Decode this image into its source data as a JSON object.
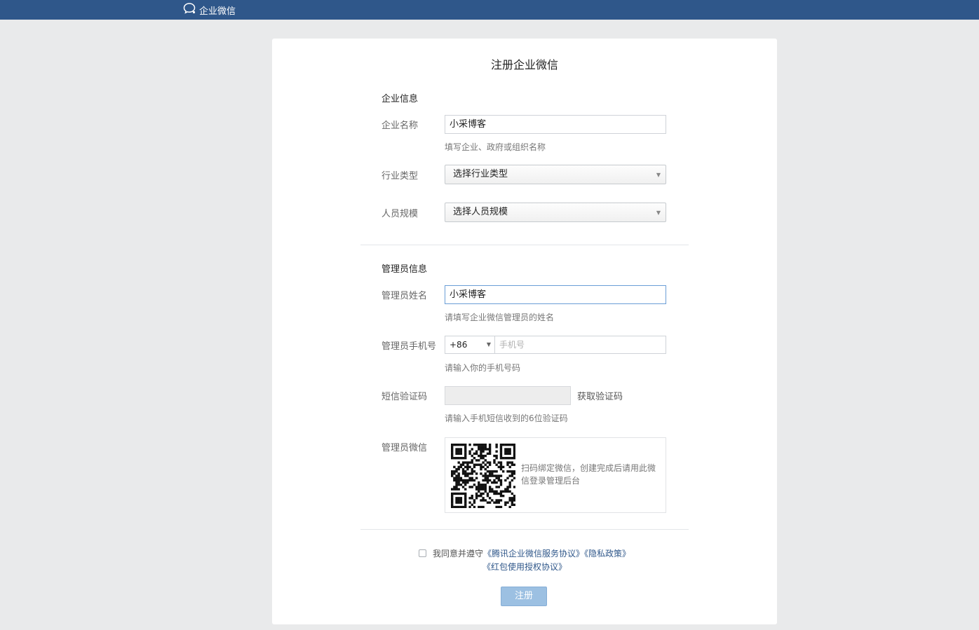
{
  "header": {
    "brand_name": "企业微信",
    "brand_icon": "chat-bubble-icon",
    "bar_color": "#2f578a"
  },
  "form": {
    "title": "注册企业微信",
    "company_section": {
      "title": "企业信息",
      "name_label": "企业名称",
      "name_value": "小采博客",
      "name_hint": "填写企业、政府或组织名称",
      "industry_label": "行业类型",
      "industry_value": "选择行业类型",
      "size_label": "人员规模",
      "size_value": "选择人员规模"
    },
    "admin_section": {
      "title": "管理员信息",
      "name_label": "管理员姓名",
      "name_value": "小采博客",
      "name_hint": "请填写企业微信管理员的姓名",
      "phone_label": "管理员手机号",
      "country_code": "+86",
      "phone_placeholder": "手机号",
      "phone_hint": "请输入你的手机号码",
      "sms_label": "短信验证码",
      "sms_button": "获取验证码",
      "sms_hint": "请输入手机短信收到的6位验证码",
      "wechat_label": "管理员微信",
      "qr_text": "扫码绑定微信，创建完成后请用此微信登录管理后台"
    },
    "agreement": {
      "prefix": "我同意并遵守",
      "service_link": "《腾讯企业微信服务协议》",
      "privacy_link": "《隐私政策》",
      "redpacket_link": "《红包使用授权协议》"
    },
    "submit_label": "注册"
  },
  "colors": {
    "link": "#2f578a",
    "submit_disabled": "#9cc0e2",
    "focus_border": "#6a9ed6"
  }
}
